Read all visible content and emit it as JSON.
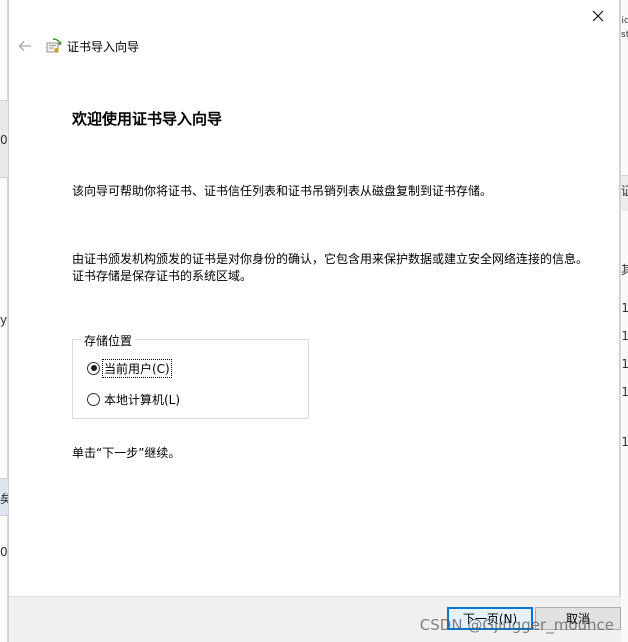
{
  "wizard": {
    "title": "证书导入向导",
    "heading": "欢迎使用证书导入向导",
    "intro": "该向导可帮助你将证书、证书信任列表和证书吊销列表从磁盘复制到证书存储。",
    "description": "由证书颁发机构颁发的证书是对你身份的确认，它包含用来保护数据或建立安全网络连接的信息。证书存储是保存证书的系统区域。",
    "store_location": {
      "legend": "存储位置",
      "options": [
        {
          "label": "当前用户(C)",
          "checked": true
        },
        {
          "label": "本地计算机(L)",
          "checked": false
        }
      ]
    },
    "continue_hint": "单击“下一步”继续。",
    "buttons": {
      "next": "下一页(N)",
      "cancel": "取消"
    }
  },
  "background_window": {
    "left_glyphs": [
      "0",
      "y",
      "矣",
      "0"
    ],
    "right_glyphs": [
      "ic",
      "st",
      "证",
      "其",
      "1",
      "1",
      "1",
      "1",
      "1"
    ]
  },
  "watermark": "CSDN @Gjingger_mouhce",
  "icons": {
    "close": "close-icon",
    "back": "back-arrow-icon",
    "wizard": "certificate-wizard-icon"
  },
  "colors": {
    "accent": "#0078d7",
    "dialog_bg": "#ffffff",
    "footer_bg": "#f0f0f0"
  }
}
